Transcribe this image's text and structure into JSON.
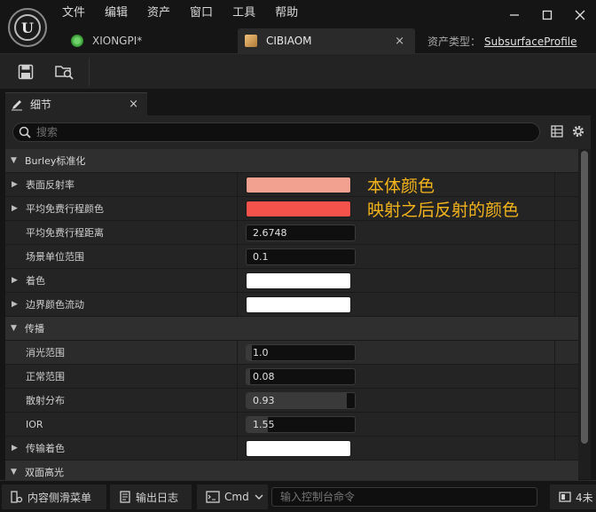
{
  "menu": [
    "文件",
    "编辑",
    "资产",
    "窗口",
    "工具",
    "帮助"
  ],
  "tabs": {
    "xiongpi": {
      "label": "XIONGPI*"
    },
    "cibiaom": {
      "label": "CIBIAOM",
      "close": "×"
    }
  },
  "asset_type": {
    "label": "资产类型：",
    "value": "SubsurfaceProfile"
  },
  "window_controls": {
    "minimize": "—",
    "maximize": "☐",
    "close": "✕"
  },
  "details_tab": {
    "label": "细节",
    "close": "×"
  },
  "search": {
    "placeholder": "搜索"
  },
  "categories": {
    "burley": "Burley标准化",
    "transmission": "传播",
    "dual_specular": "双面高光"
  },
  "props": {
    "surface_albedo": {
      "label": "表面反射率",
      "color": "#f2a090"
    },
    "mean_free_path_color": {
      "label": "平均免费行程颜色",
      "color": "#f5524c"
    },
    "mean_free_path_distance": {
      "label": "平均免费行程距离",
      "value": "2.6748"
    },
    "world_unit_scale": {
      "label": "场景单位范围",
      "value": "0.1"
    },
    "tint": {
      "label": "着色",
      "color": "#ffffff"
    },
    "boundary_color_bleed": {
      "label": "边界颜色流动",
      "color": "#ffffff"
    },
    "extinction_scale": {
      "label": "消光范围",
      "value": "1.0",
      "fill": 0.05
    },
    "normal_scale": {
      "label": "正常范围",
      "value": "0.08",
      "fill": 0.03
    },
    "scattering_distribution": {
      "label": "散射分布",
      "value": "0.93",
      "fill": 0.93
    },
    "ior": {
      "label": "IOR",
      "value": "1.55",
      "fill": 0.2
    },
    "transmission_tint": {
      "label": "传输着色",
      "color": "#ffffff"
    }
  },
  "annotations": {
    "body_color": "本体颜色",
    "reflect_color": "映射之后反射的颜色"
  },
  "statusbar": {
    "content_drawer": "内容侧滑菜单",
    "output_log": "输出日志",
    "cmd": "Cmd",
    "cmd_placeholder": "输入控制台命令",
    "trailing": "4未"
  }
}
